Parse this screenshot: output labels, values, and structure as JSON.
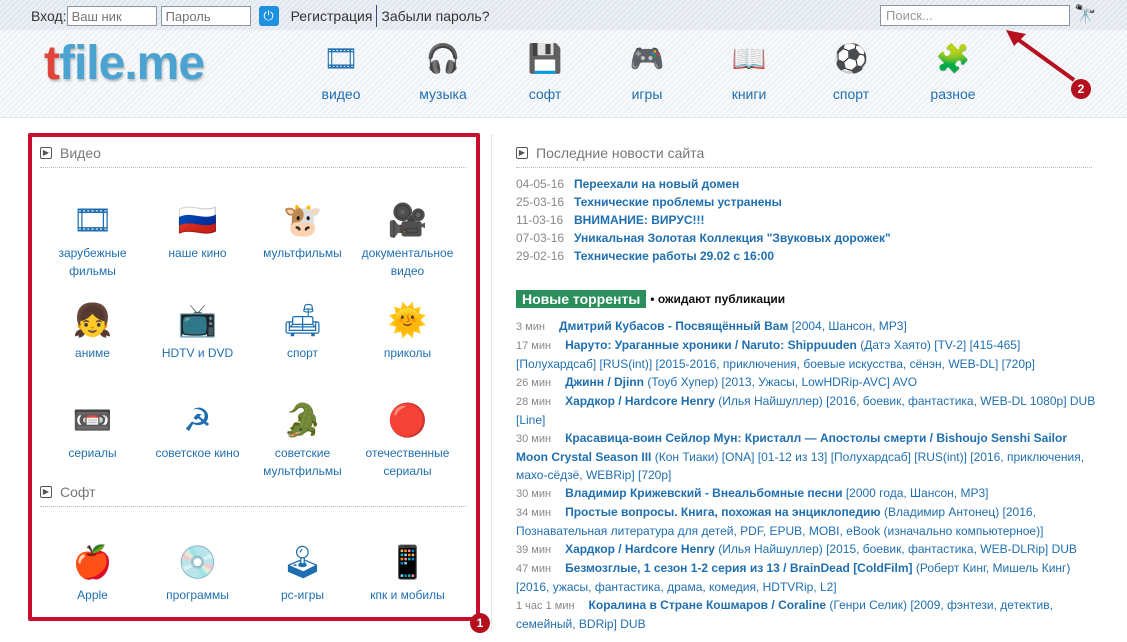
{
  "header": {
    "login_label": "Вход:",
    "nick_placeholder": "Ваш ник",
    "password_placeholder": "Пароль",
    "register": "Регистрация",
    "forgot": "Забыли пароль?",
    "search_placeholder": "Поиск...",
    "logo": "tfile.me",
    "logo_first": "t",
    "logo_rest": "file.me"
  },
  "nav": [
    {
      "label": "видео",
      "icon": "film-reel-icon",
      "g": "🎞"
    },
    {
      "label": "музыка",
      "icon": "headphones-icon",
      "g": "🎧"
    },
    {
      "label": "софт",
      "icon": "floppy-pencil-icon",
      "g": "💾"
    },
    {
      "label": "игры",
      "icon": "gamepad-icon",
      "g": "🎮"
    },
    {
      "label": "книги",
      "icon": "typewriter-icon",
      "g": "📖"
    },
    {
      "label": "спорт",
      "icon": "soccer-ball-icon",
      "g": "⚽"
    },
    {
      "label": "разное",
      "icon": "blocks-icon",
      "g": "🧩"
    }
  ],
  "video": {
    "title": "Видео",
    "items": [
      {
        "label": "зарубежные фильмы",
        "icon": "film-reel-icon",
        "g": "🎞"
      },
      {
        "label": "наше кино",
        "icon": "russia-flag-icon",
        "g": "🇷🇺"
      },
      {
        "label": "мультфильмы",
        "icon": "cartoon-cow-icon",
        "g": "🐮"
      },
      {
        "label": "документальное видео",
        "icon": "cameraman-icon",
        "g": "🎥"
      },
      {
        "label": "аниме",
        "icon": "anime-girl-icon",
        "g": "👧"
      },
      {
        "label": "HDTV и DVD",
        "icon": "tv-icon",
        "g": "📺"
      },
      {
        "label": "спорт",
        "icon": "armchair-ball-icon",
        "g": "🛋"
      },
      {
        "label": "приколы",
        "icon": "funny-sun-icon",
        "g": "🌞"
      },
      {
        "label": "сериалы",
        "icon": "film-strip-icon",
        "g": "📼"
      },
      {
        "label": "советское кино",
        "icon": "hammer-sickle-icon",
        "g": "☭"
      },
      {
        "label": "советские мультфильмы",
        "icon": "crocodile-icon",
        "g": "🐊"
      },
      {
        "label": "отечественные сериалы",
        "icon": "russia-ball-icon",
        "g": "🔴"
      }
    ]
  },
  "soft": {
    "title": "Софт",
    "items": [
      {
        "label": "Apple",
        "icon": "apple-icon",
        "g": "🍎"
      },
      {
        "label": "программы",
        "icon": "cd-icon",
        "g": "💿"
      },
      {
        "label": "pc-игры",
        "icon": "pc-games-icon",
        "g": "🕹"
      },
      {
        "label": "кпк и мобилы",
        "icon": "phone-icon",
        "g": "📱"
      }
    ]
  },
  "news": {
    "title": "Последние новости сайта",
    "items": [
      {
        "date": "04-05-16",
        "title": "Переехали на новый домен"
      },
      {
        "date": "25-03-16",
        "title": "Технические проблемы устранены"
      },
      {
        "date": "11-03-16",
        "title": "ВНИМАНИЕ: ВИРУС!!!"
      },
      {
        "date": "07-03-16",
        "title": "Уникальная Золотая Коллекция \"Звуковых дорожек\""
      },
      {
        "date": "29-02-16",
        "title": "Технические работы 29.02 с 16:00"
      }
    ]
  },
  "torrents": {
    "title": "Новые торренты",
    "subtitle": "• ожидают публикации",
    "items": [
      {
        "time": "3 мин",
        "title": "Дмитрий Кубасов - Посвящённый Вам",
        "rest": " [2004, Шансон, MP3]"
      },
      {
        "time": "17 мин",
        "title": "Наруто: Ураганные хроники / Naruto: Shippuuden",
        "rest": " (Датэ Хаято) [TV-2] [415-465] [Полухардсаб] [RUS(int)] [2015-2016, приключения, боевые искусства, сёнэн, WEB-DL] [720p]"
      },
      {
        "time": "26 мин",
        "title": "Джинн / Djinn",
        "rest": " (Тоуб Хупер) [2013, Ужасы, LowHDRip-AVC] AVO"
      },
      {
        "time": "28 мин",
        "title": "Хардкор / Hardcore Henry",
        "rest": " (Илья Найшуллер) [2016, боевик, фантастика, WEB-DL 1080p] DUB [Line]"
      },
      {
        "time": "30 мин",
        "title": "Красавица-воин Сейлор Мун: Кристалл — Апостолы смерти / Bishoujo Senshi Sailor Moon Crystal Season III",
        "rest": " (Кон Тиаки) [ONA] [01-12 из 13] [Полухардсаб] [RUS(int)] [2016, приключения, махо-сёдзё, WEBRip] [720p]"
      },
      {
        "time": "30 мин",
        "title": "Владимир Крижевский - Внеальбомные песни",
        "rest": " [2000 года, Шансон, MP3]"
      },
      {
        "time": "34 мин",
        "title": "Простые вопросы. Книга, похожая на энциклопедию",
        "rest": " (Владимир Антонец) [2016, Познавательная литература для детей, PDF, EPUB, MOBI, eBook (изначально компьютерное)]"
      },
      {
        "time": "39 мин",
        "title": "Хардкор / Hardcore Henry",
        "rest": " (Илья Найшуллер) [2015, боевик, фантастика, WEB-DLRip] DUB"
      },
      {
        "time": "47 мин",
        "title": "Безмозглые, 1 сезон 1-2 серия из 13 / BrainDead [ColdFilm]",
        "rest": " (Роберт Кинг, Мишель Кинг) [2016, ужасы, фантастика, драма, комедия, HDTVRip, L2]"
      },
      {
        "time": "1 час 1 мин",
        "title": "Коралина в Стране Кошмаров / Coraline",
        "rest": " (Генри Селик) [2009, фэнтези, детектив, семейный, BDRip] DUB"
      }
    ]
  },
  "annotations": [
    "1",
    "2"
  ],
  "colors": {
    "accent": "#1f6fb0",
    "highlight": "#c8102e",
    "badge": "#2a8f5a"
  }
}
